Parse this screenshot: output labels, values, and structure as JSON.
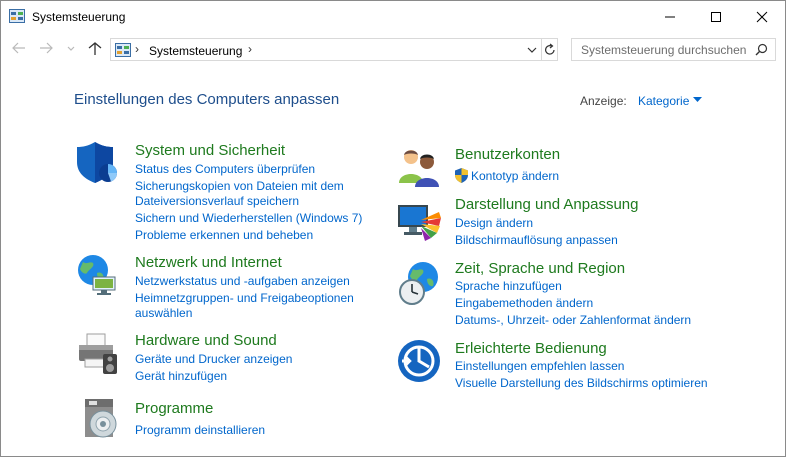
{
  "window": {
    "title": "Systemsteuerung",
    "controls": [
      "minimize-icon",
      "maximize-icon",
      "close-icon"
    ]
  },
  "address": {
    "crumb": "Systemsteuerung",
    "icons": [
      "back-icon",
      "forward-icon",
      "recent-dropdown-icon",
      "up-icon",
      "control-panel-icon",
      "chevron-down-icon",
      "refresh-icon"
    ]
  },
  "search": {
    "placeholder": "Systemsteuerung durchsuchen",
    "icon": "search-icon"
  },
  "header": {
    "title": "Einstellungen des Computers anpassen",
    "view_label": "Anzeige:",
    "view_value": "Kategorie"
  },
  "categories": {
    "system": {
      "title": "System und Sicherheit",
      "icon": "security-shield-icon",
      "links": [
        "Status des Computers überprüfen",
        "Sicherungskopien von Dateien mit dem",
        "Dateiversionsverlauf speichern",
        "Sichern und Wiederherstellen (Windows 7)",
        "Probleme erkennen und beheben"
      ]
    },
    "network": {
      "title": "Netzwerk und Internet",
      "icon": "network-globe-icon",
      "links": [
        "Netzwerkstatus und -aufgaben anzeigen",
        "Heimnetzgruppen- und Freigabeoptionen",
        "auswählen"
      ]
    },
    "hardware": {
      "title": "Hardware und Sound",
      "icon": "printer-icon",
      "links": [
        "Geräte und Drucker anzeigen",
        "Gerät hinzufügen"
      ]
    },
    "programs": {
      "title": "Programme",
      "icon": "programs-disc-icon",
      "links": [
        "Programm deinstallieren"
      ]
    },
    "users": {
      "title": "Benutzerkonten",
      "icon": "user-accounts-icon",
      "links": [
        "Kontotyp ändern"
      ]
    },
    "appearance": {
      "title": "Darstellung und Anpassung",
      "icon": "monitor-palette-icon",
      "links": [
        "Design ändern",
        "Bildschirmauflösung anpassen"
      ]
    },
    "region": {
      "title": "Zeit, Sprache und Region",
      "icon": "clock-globe-icon",
      "links": [
        "Sprache hinzufügen",
        "Eingabemethoden ändern",
        "Datums-, Uhrzeit- oder Zahlenformat ändern"
      ]
    },
    "access": {
      "title": "Erleichterte Bedienung",
      "icon": "ease-of-access-icon",
      "links": [
        "Einstellungen empfehlen lassen",
        "Visuelle Darstellung des Bildschirms optimieren"
      ]
    }
  },
  "colors": {
    "title_blue": "#1e4e8c",
    "category_green": "#1e7a1e",
    "link_blue": "#0066cc",
    "border": "#8a8a8a"
  }
}
